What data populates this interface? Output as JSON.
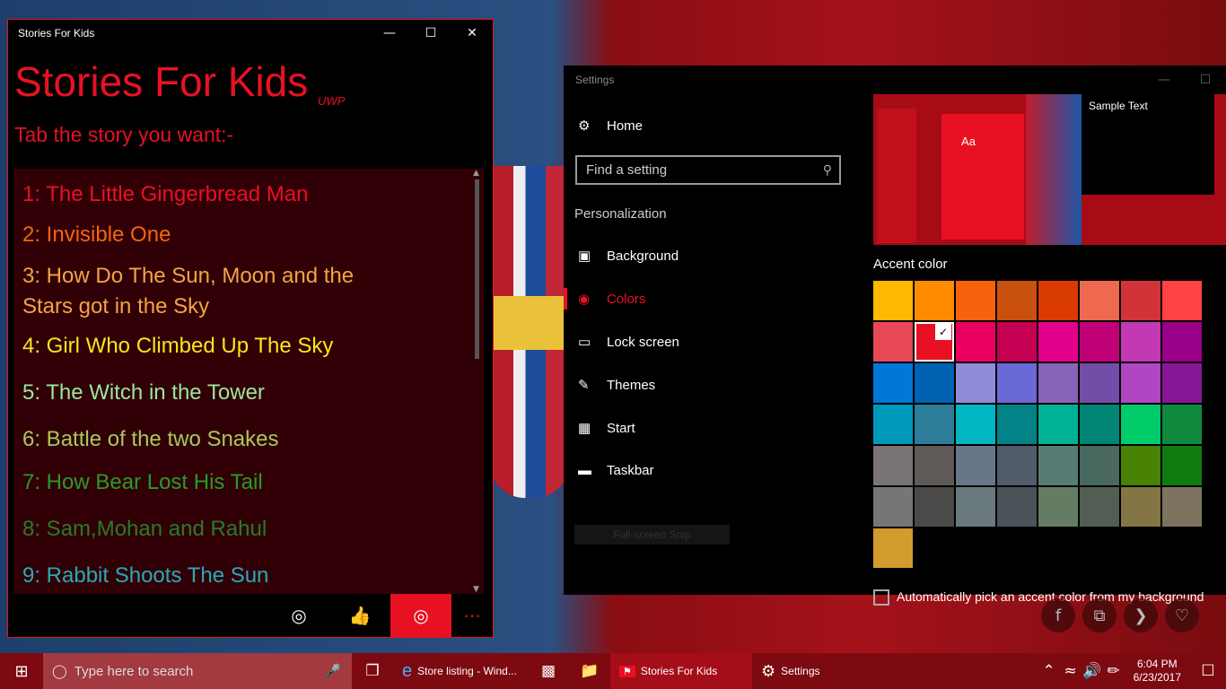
{
  "stories_window": {
    "title": "Stories For Kids",
    "app_title": "Stories For Kids",
    "uwp_tag": "UWP",
    "subtitle": "Tab the story you want:-",
    "stories": [
      {
        "text": "1: The Little Gingerbread Man",
        "color": "#e81123"
      },
      {
        "text": "2: Invisible One",
        "color": "#f7630c"
      },
      {
        "text": "3: How Do The Sun, Moon and the Stars got in the Sky",
        "color": "#f3a541"
      },
      {
        "text": "4: Girl Who Climbed Up The Sky",
        "color": "#f8e71c"
      },
      {
        "text": "5: The Witch in the Tower",
        "color": "#9ce69c"
      },
      {
        "text": "6: Battle of the two Snakes",
        "color": "#a8c85c"
      },
      {
        "text": "7: How Bear Lost His Tail",
        "color": "#2a9a2a"
      },
      {
        "text": "8: Sam,Mohan and Rahul",
        "color": "#2a7a2a"
      },
      {
        "text": "9: Rabbit Shoots The Sun",
        "color": "#2aa8b8"
      }
    ],
    "commands": [
      "eye-icon",
      "thumbs-up-icon",
      "eye-icon",
      "more-icon"
    ]
  },
  "settings_window": {
    "title": "Settings",
    "home_label": "Home",
    "search_placeholder": "Find a setting",
    "section_label": "Personalization",
    "nav_items": [
      "Background",
      "Colors",
      "Lock screen",
      "Themes",
      "Start",
      "Taskbar"
    ],
    "snip_label": "Full-screen Snip",
    "preview_aa": "Aa",
    "preview_sample_text": "Sample Text",
    "accent_label": "Accent color",
    "accent_colors": [
      "#ffb900",
      "#ff8c00",
      "#f7630c",
      "#ca5010",
      "#da3b01",
      "#ef6950",
      "#d13438",
      "#ff4343",
      "#e74856",
      "#e81123",
      "#ea005e",
      "#c30052",
      "#e3008c",
      "#bf0077",
      "#c239b3",
      "#9a0089",
      "#0078d7",
      "#0063b1",
      "#8e8cd8",
      "#6b69d6",
      "#8764b8",
      "#744da9",
      "#b146c2",
      "#881798",
      "#0099bc",
      "#2d7d9a",
      "#00b7c3",
      "#038387",
      "#00b294",
      "#018574",
      "#00cc6a",
      "#10893e",
      "#7a7574",
      "#5d5a58",
      "#68768a",
      "#515c6b",
      "#567c73",
      "#486860",
      "#498205",
      "#107c10",
      "#767676",
      "#4c4a48",
      "#69797e",
      "#4a5459",
      "#647c64",
      "#525e54",
      "#847545",
      "#7e735f",
      "#d29b2e"
    ],
    "selected_accent": "#e81123",
    "auto_pick_label": "Automatically pick an accent color from my background"
  },
  "taskbar": {
    "search_placeholder": "Type here to search",
    "apps": [
      {
        "label": "Store listing - Wind...",
        "icon": "edge-icon",
        "active": false
      },
      {
        "label": "Stories For Kids",
        "icon": "app-icon",
        "active": true
      },
      {
        "label": "Settings",
        "icon": "gear-icon",
        "active": false
      }
    ],
    "time": "6:04 PM",
    "date": "6/23/2017"
  }
}
